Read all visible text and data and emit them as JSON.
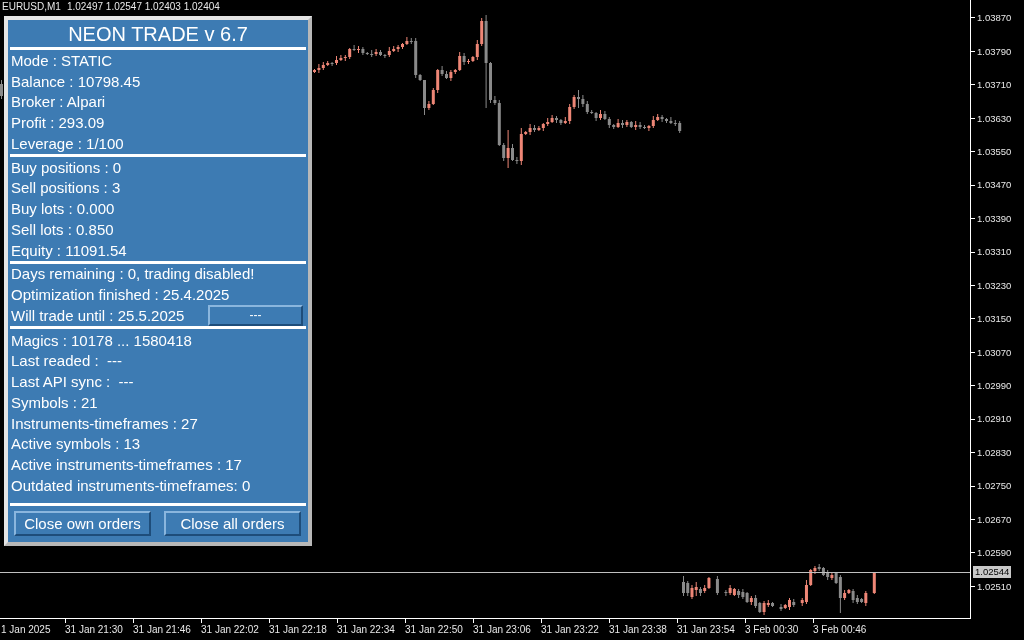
{
  "chart_header": {
    "symbol": "EURUSD,M1",
    "quote": "1.02497 1.02547 1.02403 1.02404"
  },
  "panel": {
    "title": "NEON TRADE v 6.7",
    "sections": [
      {
        "rows": [
          {
            "text": "Mode : STATIC"
          },
          {
            "text": "Balance : 10798.45"
          },
          {
            "text": "Broker : Alpari"
          },
          {
            "text": "Profit : 293.09"
          },
          {
            "text": "Leverage : 1/100"
          }
        ]
      },
      {
        "rows": [
          {
            "text": "Buy positions : 0"
          },
          {
            "text": "Sell positions : 3"
          },
          {
            "text": "Buy lots : 0.000"
          },
          {
            "text": "Sell lots : 0.850"
          },
          {
            "text": "Equity : 11091.54"
          }
        ]
      },
      {
        "rows": [
          {
            "text": "Days remaining : 0, trading disabled!"
          },
          {
            "text": "Optimization finished : 25.4.2025"
          },
          {
            "text": "Will trade until : 25.5.2025",
            "button": "---"
          }
        ]
      },
      {
        "rows": [
          {
            "text": "Magics : 10178 ... 1580418"
          },
          {
            "text": "Last readed :  ---"
          },
          {
            "text": "Last API sync :  ---"
          },
          {
            "text": "Symbols : 21"
          },
          {
            "text": "Instruments-timeframes : 27"
          },
          {
            "text": "Active symbols : 13"
          },
          {
            "text": "Active instruments-timeframes : 17"
          },
          {
            "text": "Outdated instruments-timeframes: 0"
          }
        ]
      }
    ],
    "buttons": [
      "Close own orders",
      "Close all orders"
    ]
  },
  "price_axis": {
    "labels": [
      "1.03870",
      "1.03790",
      "1.03710",
      "1.03630",
      "1.03550",
      "1.03470",
      "1.03390",
      "1.03310",
      "1.03230",
      "1.03150",
      "1.03070",
      "1.02990",
      "1.02910",
      "1.02830",
      "1.02750",
      "1.02670",
      "1.02590",
      "1.02510"
    ],
    "current_price": "1.02544"
  },
  "time_axis": {
    "labels": [
      "1 Jan 2025",
      "31 Jan 21:30",
      "31 Jan 21:46",
      "31 Jan 22:02",
      "31 Jan 22:18",
      "31 Jan 22:34",
      "31 Jan 22:50",
      "31 Jan 23:06",
      "31 Jan 23:22",
      "31 Jan 23:38",
      "31 Jan 23:54",
      "3 Feb 00:30",
      "3 Feb 00:46"
    ]
  }
}
